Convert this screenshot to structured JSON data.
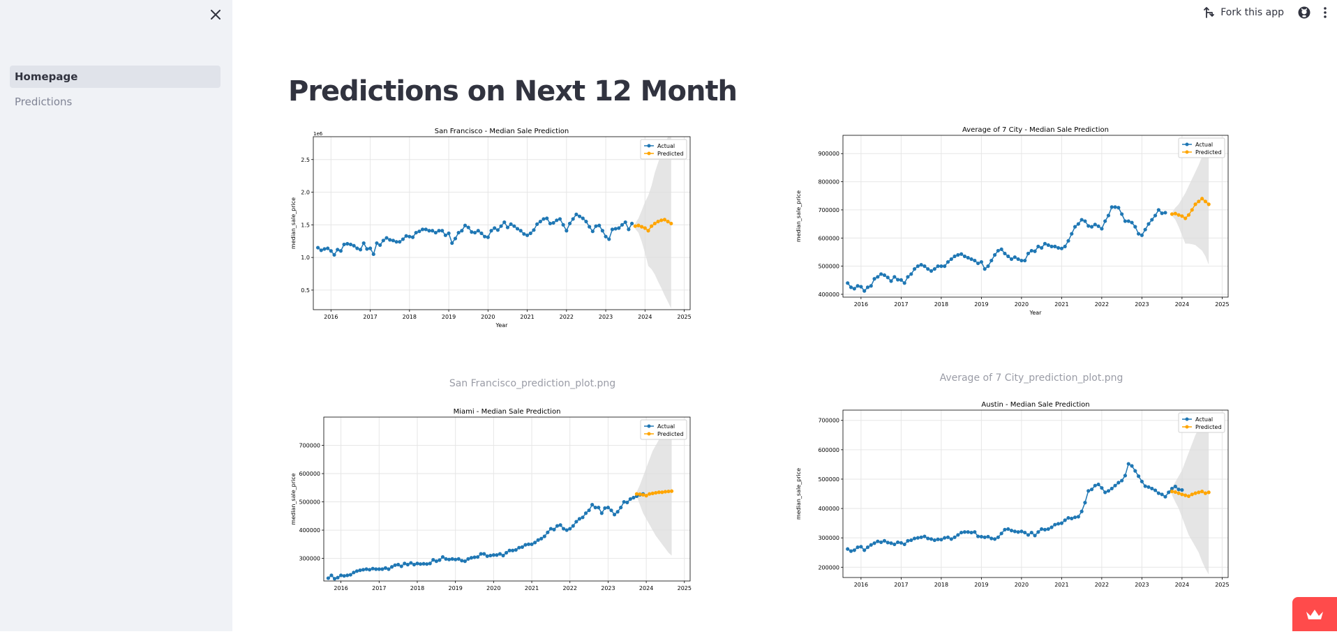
{
  "sidebar": {
    "nav": [
      {
        "label": "Homepage",
        "active": true
      },
      {
        "label": "Predictions",
        "active": false
      }
    ],
    "close_icon": "close-icon"
  },
  "topbar": {
    "fork_label": "Fork this app",
    "fork_icon": "fork-icon",
    "github_icon": "github-icon",
    "menu_icon": "kebab-menu-icon"
  },
  "main": {
    "title": "Predictions on Next 12 Month"
  },
  "captions": {
    "sf": "San Francisco_prediction_plot.png",
    "avg": "Average of 7 City_prediction_plot.png"
  },
  "colors": {
    "actual": "#1f77b4",
    "predicted": "#ffa500",
    "band": "#dcdcdc",
    "accent": "#ff4b4b"
  },
  "chart_data": [
    {
      "id": "sf",
      "type": "line",
      "title": "San Francisco - Median Sale Prediction",
      "xlabel": "Year",
      "ylabel": "median_sale_price",
      "y_scale_label": "1e6",
      "xlim": [
        2015.55,
        2025.15
      ],
      "ylim": [
        0.2,
        2.85
      ],
      "xticks": [
        2016,
        2017,
        2018,
        2019,
        2020,
        2021,
        2022,
        2023,
        2024,
        2025
      ],
      "yticks": [
        0.5,
        1.0,
        1.5,
        2.0,
        2.5
      ],
      "ytick_labels": [
        "0.5",
        "1.0",
        "1.5",
        "2.0",
        "2.5"
      ],
      "legend": [
        "Actual",
        "Predicted"
      ],
      "legend_position": "top-right",
      "grid": true,
      "actual_start": 2015.667,
      "actual": [
        1.15,
        1.11,
        1.13,
        1.14,
        1.1,
        1.04,
        1.12,
        1.1,
        1.2,
        1.21,
        1.2,
        1.18,
        1.14,
        1.12,
        1.22,
        1.13,
        1.14,
        1.05,
        1.22,
        1.19,
        1.26,
        1.3,
        1.27,
        1.26,
        1.24,
        1.24,
        1.28,
        1.33,
        1.32,
        1.31,
        1.38,
        1.4,
        1.43,
        1.43,
        1.41,
        1.41,
        1.38,
        1.41,
        1.41,
        1.34,
        1.37,
        1.22,
        1.29,
        1.38,
        1.41,
        1.49,
        1.46,
        1.39,
        1.38,
        1.41,
        1.37,
        1.32,
        1.31,
        1.41,
        1.45,
        1.42,
        1.48,
        1.54,
        1.46,
        1.51,
        1.48,
        1.44,
        1.41,
        1.36,
        1.34,
        1.37,
        1.42,
        1.51,
        1.55,
        1.59,
        1.6,
        1.52,
        1.53,
        1.57,
        1.59,
        1.5,
        1.41,
        1.52,
        1.59,
        1.66,
        1.63,
        1.6,
        1.55,
        1.47,
        1.4,
        1.48,
        1.49,
        1.41,
        1.32,
        1.28,
        1.43,
        1.44,
        1.45,
        1.5,
        1.54,
        1.43,
        1.52
      ],
      "predicted_start": 2023.75,
      "predicted": [
        1.48,
        1.49,
        1.47,
        1.45,
        1.41,
        1.48,
        1.52,
        1.55,
        1.57,
        1.58,
        1.55,
        1.52
      ],
      "upper": [
        1.52,
        1.6,
        1.72,
        1.85,
        1.95,
        2.1,
        2.3,
        2.45,
        2.6,
        2.72,
        2.85,
        2.85
      ],
      "lower": [
        1.44,
        1.38,
        1.24,
        1.07,
        0.87,
        0.82,
        0.74,
        0.63,
        0.53,
        0.42,
        0.32,
        0.22
      ]
    },
    {
      "id": "avg",
      "type": "line",
      "title": "Average of 7 City - Median Sale Prediction",
      "xlabel": "Year",
      "ylabel": "median_sale_price",
      "xlim": [
        2015.55,
        2025.15
      ],
      "ylim": [
        390000,
        965000
      ],
      "xticks": [
        2016,
        2017,
        2018,
        2019,
        2020,
        2021,
        2022,
        2023,
        2024,
        2025
      ],
      "yticks": [
        400000,
        500000,
        600000,
        700000,
        800000,
        900000
      ],
      "ytick_labels": [
        "400000",
        "500000",
        "600000",
        "700000",
        "800000",
        "900000"
      ],
      "legend": [
        "Actual",
        "Predicted"
      ],
      "legend_position": "top-right",
      "grid": true,
      "actual_start": 2015.667,
      "actual": [
        440000,
        425000,
        420000,
        430000,
        427000,
        412000,
        425000,
        430000,
        455000,
        462000,
        472000,
        468000,
        460000,
        447000,
        462000,
        452000,
        451000,
        440000,
        462000,
        472000,
        490000,
        500000,
        505000,
        500000,
        490000,
        483000,
        490000,
        500000,
        500000,
        500000,
        515000,
        525000,
        535000,
        540000,
        543000,
        535000,
        530000,
        525000,
        520000,
        510000,
        515000,
        490000,
        500000,
        520000,
        540000,
        555000,
        560000,
        545000,
        535000,
        525000,
        532000,
        525000,
        520000,
        520000,
        545000,
        555000,
        553000,
        570000,
        565000,
        580000,
        575000,
        570000,
        570000,
        565000,
        563000,
        570000,
        590000,
        615000,
        640000,
        650000,
        665000,
        660000,
        643000,
        640000,
        648000,
        642000,
        633000,
        660000,
        680000,
        710000,
        710000,
        708000,
        685000,
        660000,
        660000,
        655000,
        640000,
        615000,
        610000,
        630000,
        650000,
        665000,
        680000,
        700000,
        688000,
        690000
      ],
      "predicted_start": 2023.75,
      "predicted": [
        685000,
        687000,
        682000,
        678000,
        670000,
        682000,
        700000,
        720000,
        730000,
        740000,
        730000,
        720000
      ],
      "upper": [
        690000,
        708000,
        720000,
        740000,
        760000,
        785000,
        810000,
        835000,
        860000,
        890000,
        920000,
        960000
      ],
      "lower": [
        680000,
        665000,
        640000,
        610000,
        580000,
        580000,
        578000,
        575000,
        565000,
        555000,
        535000,
        505000
      ]
    },
    {
      "id": "miami",
      "type": "line",
      "title": "Miami - Median Sale Prediction",
      "xlabel": "",
      "ylabel": "median_sale_price",
      "xlim": [
        2015.55,
        2025.15
      ],
      "ylim": [
        220000,
        800000
      ],
      "xticks": [
        2016,
        2017,
        2018,
        2019,
        2020,
        2021,
        2022,
        2023,
        2024,
        2025
      ],
      "yticks": [
        300000,
        400000,
        500000,
        600000,
        700000
      ],
      "ytick_labels": [
        "300000",
        "400000",
        "500000",
        "600000",
        "700000"
      ],
      "legend": [
        "Actual",
        "Predicted"
      ],
      "legend_position": "top-right",
      "grid": true,
      "actual_start": 2015.667,
      "actual": [
        230000,
        240000,
        228000,
        232000,
        240000,
        238000,
        240000,
        242000,
        250000,
        255000,
        258000,
        260000,
        262000,
        260000,
        264000,
        262000,
        262000,
        262000,
        266000,
        262000,
        270000,
        276000,
        278000,
        272000,
        282000,
        278000,
        284000,
        278000,
        282000,
        280000,
        281000,
        280000,
        282000,
        295000,
        290000,
        294000,
        305000,
        298000,
        296000,
        298000,
        296000,
        298000,
        292000,
        290000,
        298000,
        302000,
        304000,
        305000,
        316000,
        316000,
        308000,
        310000,
        312000,
        312000,
        316000,
        310000,
        320000,
        328000,
        328000,
        330000,
        338000,
        340000,
        348000,
        350000,
        350000,
        356000,
        365000,
        370000,
        378000,
        392000,
        405000,
        402000,
        415000,
        418000,
        405000,
        400000,
        405000,
        415000,
        430000,
        440000,
        445000,
        460000,
        470000,
        490000,
        480000,
        480000,
        460000,
        478000,
        480000,
        470000,
        455000,
        465000,
        480000,
        500000,
        498000,
        510000,
        515000,
        520000,
        525000,
        528000
      ],
      "predicted_start": 2023.75,
      "predicted": [
        528000,
        527000,
        525000,
        522000,
        528000,
        530000,
        532000,
        534000,
        534000,
        536000,
        537000,
        538000
      ],
      "upper": [
        535000,
        560000,
        590000,
        620000,
        650000,
        680000,
        700000,
        720000,
        740000,
        760000,
        775000,
        790000
      ],
      "lower": [
        520000,
        490000,
        460000,
        440000,
        420000,
        400000,
        380000,
        365000,
        350000,
        335000,
        320000,
        310000
      ]
    },
    {
      "id": "austin",
      "type": "line",
      "title": "Austin - Median Sale Prediction",
      "xlabel": "",
      "ylabel": "median_sale_price",
      "xlim": [
        2015.55,
        2025.15
      ],
      "ylim": [
        165000,
        735000
      ],
      "xticks": [
        2016,
        2017,
        2018,
        2019,
        2020,
        2021,
        2022,
        2023,
        2024,
        2025
      ],
      "yticks": [
        200000,
        300000,
        400000,
        500000,
        600000,
        700000
      ],
      "ytick_labels": [
        "200000",
        "300000",
        "400000",
        "500000",
        "600000",
        "700000"
      ],
      "legend": [
        "Actual",
        "Predicted"
      ],
      "legend_position": "top-right",
      "grid": true,
      "actual_start": 2015.667,
      "actual": [
        262000,
        255000,
        258000,
        268000,
        270000,
        258000,
        268000,
        276000,
        282000,
        288000,
        285000,
        290000,
        284000,
        282000,
        278000,
        285000,
        283000,
        278000,
        290000,
        292000,
        298000,
        300000,
        302000,
        305000,
        298000,
        296000,
        292000,
        295000,
        294000,
        300000,
        302000,
        296000,
        302000,
        310000,
        318000,
        320000,
        320000,
        318000,
        320000,
        305000,
        304000,
        302000,
        304000,
        298000,
        296000,
        302000,
        315000,
        328000,
        330000,
        325000,
        322000,
        320000,
        322000,
        318000,
        310000,
        318000,
        308000,
        320000,
        330000,
        328000,
        330000,
        336000,
        345000,
        348000,
        350000,
        360000,
        368000,
        366000,
        370000,
        372000,
        390000,
        420000,
        460000,
        465000,
        478000,
        482000,
        470000,
        455000,
        460000,
        468000,
        478000,
        488000,
        495000,
        512000,
        552000,
        545000,
        528000,
        510000,
        492000,
        476000,
        473000,
        468000,
        462000,
        452000,
        448000,
        440000,
        455000,
        468000,
        475000,
        465000,
        463000
      ],
      "predicted_start": 2023.75,
      "predicted": [
        458000,
        456000,
        452000,
        448000,
        445000,
        442000,
        448000,
        452000,
        455000,
        458000,
        452000,
        455000
      ],
      "upper": [
        470000,
        490000,
        510000,
        530000,
        560000,
        590000,
        620000,
        650000,
        670000,
        690000,
        700000,
        710000
      ],
      "lower": [
        446000,
        422000,
        400000,
        370000,
        340000,
        310000,
        290000,
        270000,
        250000,
        220000,
        195000,
        175000
      ]
    }
  ]
}
